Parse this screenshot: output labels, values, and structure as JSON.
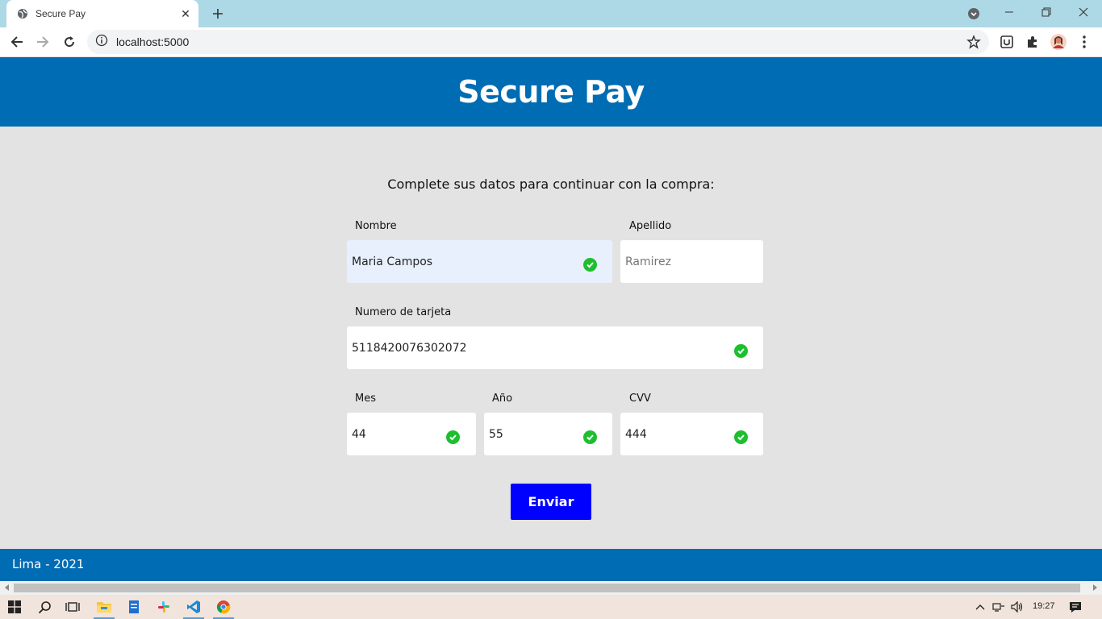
{
  "browser": {
    "tab_title": "Secure Pay",
    "url": "localhost:5000"
  },
  "page": {
    "title": "Secure Pay",
    "intro": "Complete sus datos para continuar con la compra:",
    "form": {
      "nombre": {
        "label": "Nombre",
        "value": "Maria Campos"
      },
      "apellido": {
        "label": "Apellido",
        "placeholder": "Ramirez"
      },
      "tarjeta": {
        "label": "Numero de tarjeta",
        "value": "5118420076302072"
      },
      "mes": {
        "label": "Mes",
        "value": "44"
      },
      "anio": {
        "label": "Año",
        "value": "55"
      },
      "cvv": {
        "label": "CVV",
        "value": "444"
      },
      "submit_label": "Enviar"
    },
    "footer": "Lima - 2021"
  },
  "taskbar": {
    "time": "19:27"
  },
  "colors": {
    "brand": "#006cb3",
    "button": "#0000ff",
    "valid": "#1dbf2f"
  }
}
